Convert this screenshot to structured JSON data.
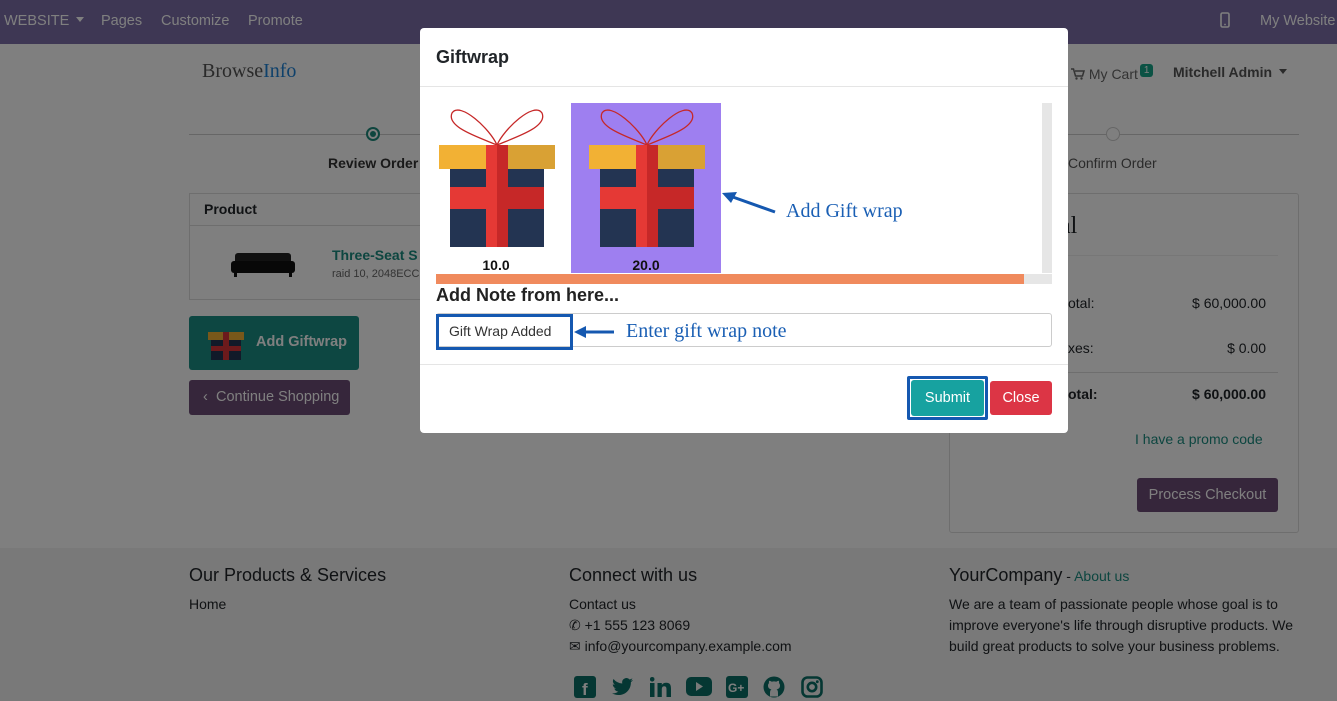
{
  "topbar": {
    "website_label": "WEBSITE",
    "pages_label": "Pages",
    "customize_label": "Customize",
    "promote_label": "Promote",
    "my_website_label": "My Website"
  },
  "header": {
    "brand_part1": "Browse",
    "brand_part2": "Info",
    "cart_label": "My Cart",
    "cart_count": "1",
    "user_label": "Mitchell Admin"
  },
  "steps": [
    {
      "label": "Review Order"
    },
    {
      "label": "Confirm Order"
    }
  ],
  "cart": {
    "product_header": "Product",
    "product_name": "Three-Seat S",
    "product_desc": "raid 10, 2048ECC"
  },
  "buttons": {
    "add_giftwrap": "Add Giftwrap",
    "continue_shopping": "Continue Shopping",
    "process_checkout": "Process Checkout",
    "promo_code": "I have a promo code"
  },
  "summary": {
    "title_fragment": "al",
    "subtotal_label": "otal:",
    "subtotal_value": "$ 60,000.00",
    "taxes_label": "xes:",
    "taxes_value": "$ 0.00",
    "total_label": "otal:",
    "total_value": "$ 60,000.00"
  },
  "footer": {
    "col1_title": "Our Products & Services",
    "home_link": "Home",
    "col2_title": "Connect with us",
    "contact_link": "Contact us",
    "phone": "+1 555 123 8069",
    "email": "info@yourcompany.example.com",
    "col3_title": "YourCompany",
    "col3_dash": " - ",
    "about_link": "About us",
    "about_text": "We are a team of passionate people whose goal is to improve everyone's life through disruptive products. We build great products to solve your business problems."
  },
  "social_icons": [
    "facebook-icon",
    "twitter-icon",
    "linkedin-icon",
    "youtube-icon",
    "googleplus-icon",
    "github-icon",
    "instagram-icon"
  ],
  "modal": {
    "title": "Giftwrap",
    "options": [
      {
        "price": "10.0",
        "selected": false
      },
      {
        "price": "20.0",
        "selected": true
      }
    ],
    "note_heading": "Add Note from here...",
    "note_value": "Gift Wrap Added",
    "submit_label": "Submit",
    "close_label": "Close",
    "annotation_gift": "Add Gift wrap",
    "annotation_note": "Enter gift wrap note"
  },
  "colors": {
    "topbar": "#7c6fa8",
    "teal": "#17a2a0",
    "danger": "#dc3545",
    "selected_option_bg": "#9e7ff0",
    "annotation_blue": "#1558b0",
    "scrollbar_orange": "#f08a5d"
  }
}
